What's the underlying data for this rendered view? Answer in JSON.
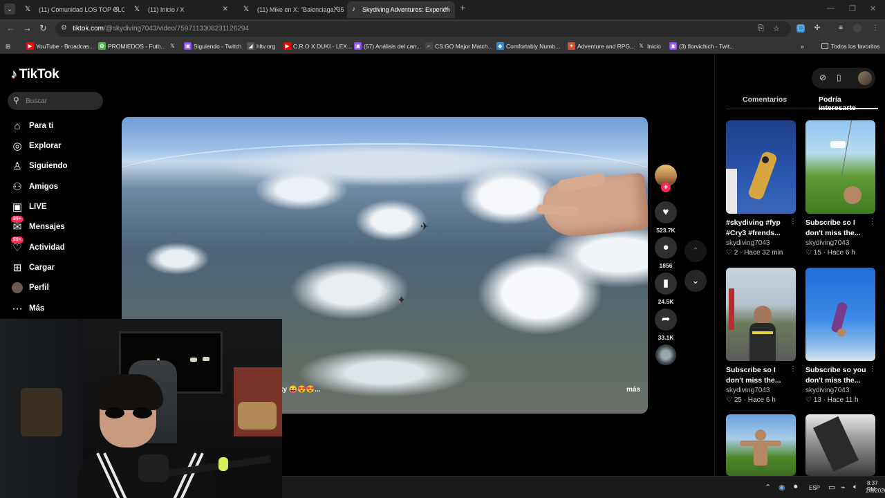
{
  "browser": {
    "tabs": [
      {
        "icon": "𝕏",
        "title": "(11) Comunidad LOS TOP GLOB"
      },
      {
        "icon": "𝕏",
        "title": "(11) Inicio / X"
      },
      {
        "icon": "𝕏",
        "title": "(11) Mike en X: \"Balenciaga, 35"
      },
      {
        "icon": "♪",
        "title": "Skydiving Adventures: Experien"
      }
    ],
    "url_host": "tiktok.com",
    "url_path": "/@skydiving7043/video/7597113308231126294",
    "bookmarks": [
      {
        "icon": "▶",
        "color": "#ff0000",
        "label": "YouTube - Broadcas..."
      },
      {
        "icon": "✿",
        "color": "#4caf50",
        "label": "PROMIEDOS - Futb..."
      },
      {
        "icon": "𝕏",
        "color": "#333333",
        "label": ""
      },
      {
        "icon": "▣",
        "color": "#9146ff",
        "label": "Siguiendo - Twitch"
      },
      {
        "icon": "◢",
        "color": "#555555",
        "label": "hltv.org"
      },
      {
        "icon": "▶",
        "color": "#ff0000",
        "label": "C.R.O X DUKI - LEX..."
      },
      {
        "icon": "▣",
        "color": "#9146ff",
        "label": "(57) Análisis del can..."
      },
      {
        "icon": "⌐",
        "color": "#444444",
        "label": "CS:GO Major Match..."
      },
      {
        "icon": "◆",
        "color": "#2a8ad4",
        "label": "Comfortably Numb..."
      },
      {
        "icon": "✦",
        "color": "#e04a2f",
        "label": "Adventure and RPG..."
      },
      {
        "icon": "𝕏",
        "color": "#333333",
        "label": "Inicio"
      },
      {
        "icon": "▣",
        "color": "#9146ff",
        "label": "(3) florvichich - Twit..."
      }
    ],
    "all_bookmarks": "Todos los favoritos"
  },
  "tiktok": {
    "logo": "TikTok",
    "search_placeholder": "Buscar",
    "nav": [
      {
        "icon": "⌂",
        "label": "Para ti",
        "badge": ""
      },
      {
        "icon": "◎",
        "label": "Explorar",
        "badge": ""
      },
      {
        "icon": "♙",
        "label": "Siguiendo",
        "badge": ""
      },
      {
        "icon": "⚇",
        "label": "Amigos",
        "badge": ""
      },
      {
        "icon": "▣",
        "label": "LIVE",
        "badge": ""
      },
      {
        "icon": "✉",
        "label": "Mensajes",
        "badge": "99+"
      },
      {
        "icon": "♡",
        "label": "Actividad",
        "badge": "99+"
      },
      {
        "icon": "⊞",
        "label": "Cargar",
        "badge": ""
      },
      {
        "icon": "",
        "label": "Perfil",
        "badge": ""
      },
      {
        "icon": "⋯",
        "label": "Más",
        "badge": ""
      }
    ],
    "video": {
      "caption_fragment": "ky 😝😍😍...",
      "more": "más"
    },
    "actions": {
      "likes": "523.7K",
      "comments": "1856",
      "saves": "24.5K",
      "shares": "33.1K"
    },
    "panel": {
      "tabs": [
        "Comentarios",
        "Podría interesarte"
      ],
      "cards": [
        {
          "caption": "#skydiving #fyp #Cry3 #frends...",
          "author": "skydiving7043",
          "likes": "2",
          "age": "Hace 32 min"
        },
        {
          "caption": "Subscribe so I don't miss the...",
          "author": "skydiving7043",
          "likes": "15",
          "age": "Hace 6 h"
        },
        {
          "caption": "Subscribe so I don't miss the...",
          "author": "skydiving7043",
          "likes": "25",
          "age": "Hace 6 h"
        },
        {
          "caption": "Subscribe so you don't miss the...",
          "author": "skydiving7043",
          "likes": "13",
          "age": "Hace 11 h"
        }
      ]
    }
  },
  "taskbar": {
    "lang": "ESP",
    "time": "8:37 PM",
    "date": "2/8/2026"
  }
}
